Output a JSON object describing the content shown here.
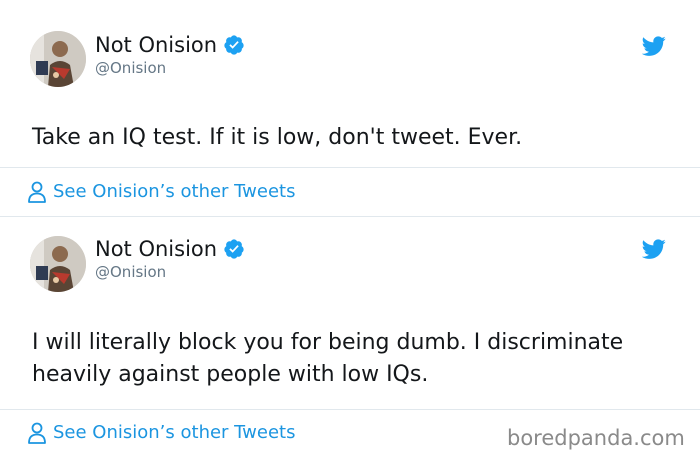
{
  "tweets": [
    {
      "name": "Not Onision",
      "handle": "@Onision",
      "text": "Take an IQ test. If it is low, don't tweet. Ever.",
      "see_other": "See Onision’s other Tweets"
    },
    {
      "name": "Not Onision",
      "handle": "@Onision",
      "text": "I will literally block you for being dumb. I discriminate heavily against people with low IQs.",
      "see_other": "See Onision’s other Tweets"
    }
  ],
  "watermark": "boredpanda.com",
  "colors": {
    "link": "#1b95e0",
    "verified": "#1da1f2",
    "twitter_bird": "#1da1f2",
    "name": "#14171a",
    "handle": "#657786",
    "divider": "#e1e8ed",
    "watermark": "#8a8a8a"
  },
  "icons": {
    "verified": "verified-badge-icon",
    "bird": "twitter-bird-icon",
    "person": "person-icon"
  }
}
